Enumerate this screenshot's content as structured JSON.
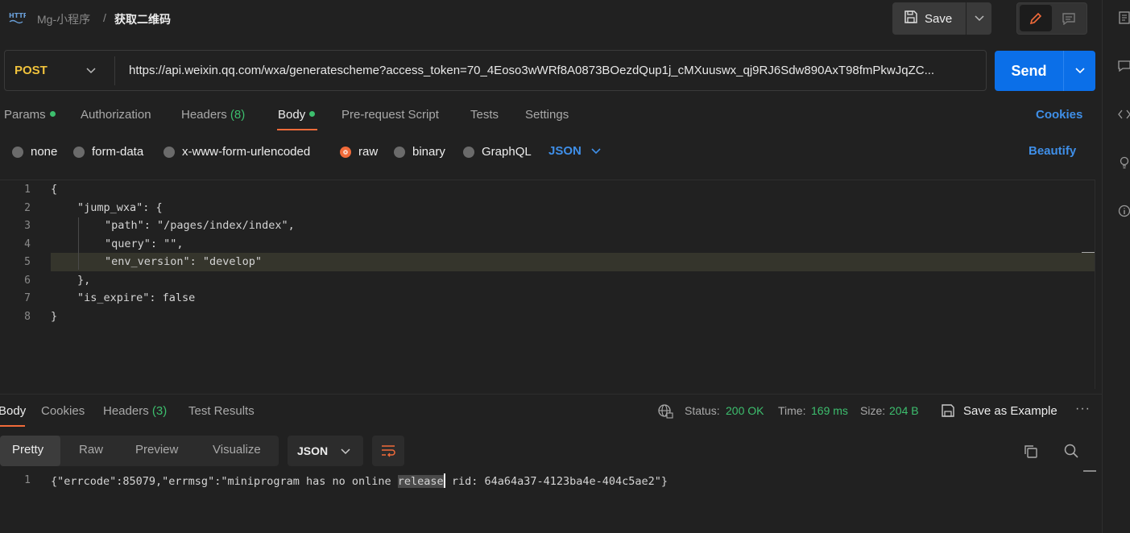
{
  "breadcrumb": {
    "icon": "http-icon",
    "collection": "Mg-小程序",
    "separator": "/",
    "request": "获取二维码"
  },
  "toolbar": {
    "save_label": "Save"
  },
  "request": {
    "method": "POST",
    "url": "https://api.weixin.qq.com/wxa/generatescheme?access_token=70_4Eoso3wWRf8A0873BOezdQup1j_cMXuuswx_qj9RJ6Sdw890AxT98fmPkwJqZC...",
    "send_label": "Send"
  },
  "request_tabs": [
    {
      "label": "Params",
      "dot": true
    },
    {
      "label": "Authorization"
    },
    {
      "label": "Headers",
      "count": "(8)"
    },
    {
      "label": "Body",
      "dot": true,
      "active": true
    },
    {
      "label": "Pre-request Script"
    },
    {
      "label": "Tests"
    },
    {
      "label": "Settings"
    }
  ],
  "cookies_label": "Cookies",
  "body_types": [
    "none",
    "form-data",
    "x-www-form-urlencoded",
    "raw",
    "binary",
    "GraphQL"
  ],
  "body_type_selected": "raw",
  "body_format": "JSON",
  "beautify_label": "Beautify",
  "editor": {
    "line_numbers": [
      "1",
      "2",
      "3",
      "4",
      "5",
      "6",
      "7",
      "8"
    ],
    "lines": [
      "{",
      "\"jump_wxa\": {",
      "\"path\": \"/pages/index/index\",",
      "\"query\": \"\",",
      "\"env_version\": \"develop\"",
      "},",
      "\"is_expire\": false",
      "}"
    ]
  },
  "response": {
    "tabs": [
      "Body",
      "Cookies",
      "Headers",
      "Test Results"
    ],
    "headers_count": "(3)",
    "status_label": "Status:",
    "status_value": "200 OK",
    "time_label": "Time:",
    "time_value": "169 ms",
    "size_label": "Size:",
    "size_value": "204 B",
    "save_example_label": "Save as Example",
    "more_label": "···",
    "view_modes": [
      "Pretty",
      "Raw",
      "Preview",
      "Visualize"
    ],
    "format": "JSON",
    "line_number": "1",
    "body_before": "{\"errcode\":85079,\"errmsg\":\"miniprogram has no online ",
    "body_selected": "release",
    "body_after": " rid: 64a64a37-4123ba4e-404c5ae2\"}"
  },
  "colors": {
    "accent_orange": "#f26b3a",
    "send_blue": "#0b6fe8",
    "link_blue": "#3f8fe8",
    "status_green": "#3dbf6e",
    "method_yellow": "#f0c23c"
  }
}
